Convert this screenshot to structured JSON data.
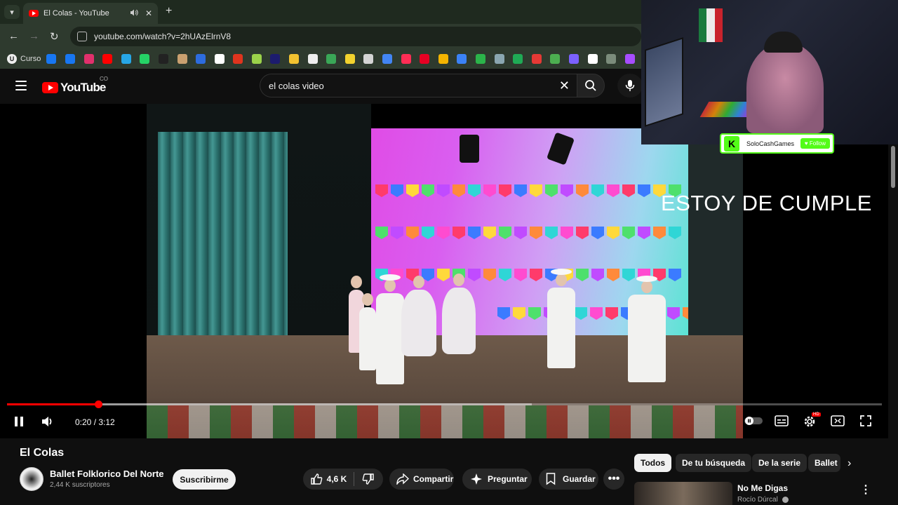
{
  "browser": {
    "tab_title": "El Colas - YouTube",
    "tab_close": "✕",
    "new_tab": "+",
    "url": "youtube.com/watch?v=2hUAzElrnV8",
    "bookmark_first_label": "Curso",
    "bookmark_first_initial": "U",
    "bookmark_colors": [
      "#1877f2",
      "#1877f2",
      "#e1306c",
      "#ff0000",
      "#27a7e7",
      "#25d366",
      "#222222",
      "#c9a070",
      "#2d6cdf",
      "#ffffff",
      "#e0341e",
      "#9bd24a",
      "#1c1c6e",
      "#f2c230",
      "#eeeeee",
      "#3aa757",
      "#f2d22e",
      "#d4d4d4",
      "#4285f4",
      "#ff2d55",
      "#e60023",
      "#f4b400",
      "#3b82f6",
      "#2bb44a",
      "#8aa6b0",
      "#1faa55",
      "#e53935",
      "#4caf50",
      "#7b61ff",
      "#ffffff",
      "#7b8c7b",
      "#a64dff"
    ]
  },
  "youtube": {
    "logo_text": "YouTube",
    "region": "CO",
    "search_value": "el colas video"
  },
  "player": {
    "overlay_text": "ESTOY DE CUMPLE",
    "current_time": "0:20",
    "duration": "3:12",
    "time_display": "0:20 / 3:12",
    "progress_fraction": 0.104,
    "buffered_fraction": 0.6,
    "hd_badge": "HD"
  },
  "stream_overlay": {
    "platform_initial": "K",
    "channel": "SoloCashGames",
    "follow_label": "Follow"
  },
  "video": {
    "title": "El Colas",
    "channel_name": "Ballet Folklorico Del Norte",
    "subscribers": "2,44 K suscriptores",
    "subscribe_label": "Suscribirme",
    "likes": "4,6 K",
    "share_label": "Compartir",
    "ask_label": "Preguntar",
    "save_label": "Guardar"
  },
  "sidebar": {
    "chips": [
      "Todos",
      "De tu búsqueda",
      "De la serie",
      "Ballet"
    ],
    "recommendation": {
      "title": "No Me Digas",
      "channel": "Rocío Dúrcal"
    }
  },
  "colors": {
    "accent": "#ff0000",
    "kick_green": "#53fc18",
    "background": "#0f0f0f"
  }
}
